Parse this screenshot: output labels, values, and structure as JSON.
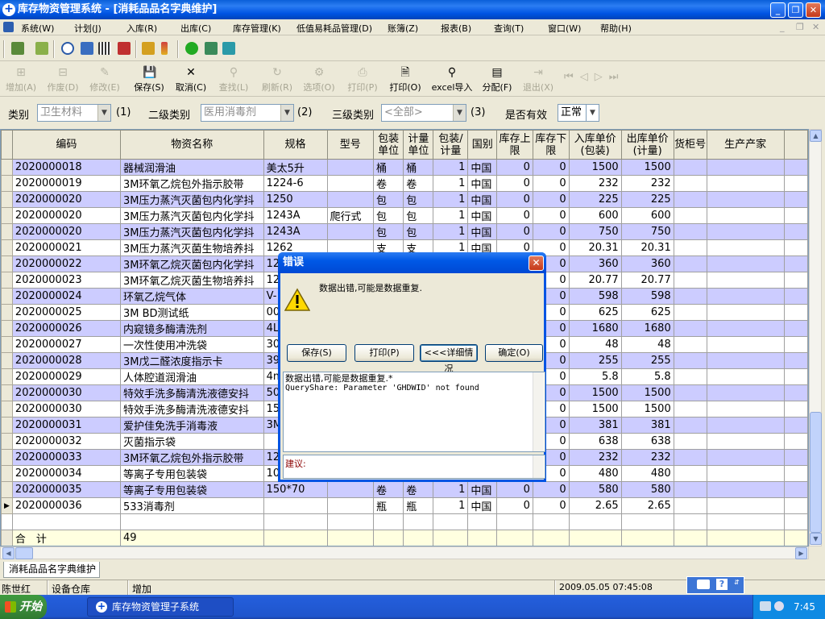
{
  "window": {
    "title": "库存物资管理系统 - [消耗品品名字典维护]"
  },
  "menu": [
    "系统(W)",
    "计划(J)",
    "入库(R)",
    "出库(C)",
    "库存管理(K)",
    "低值易耗品管理(D)",
    "账簿(Z)",
    "报表(B)",
    "查询(T)",
    "窗口(W)",
    "帮助(H)"
  ],
  "toolbar": {
    "add": "增加(A)",
    "void": "作废(D)",
    "modify": "修改(E)",
    "save": "保存(S)",
    "cancel": "取消(C)",
    "find": "查找(L)",
    "refresh": "刷新(R)",
    "options": "选项(O)",
    "print_dis": "打印(P)",
    "print": "打印(O)",
    "excel": "excel导入",
    "assign": "分配(F)",
    "exit": "退出(X)"
  },
  "filters": {
    "category_label": "类别",
    "category_value": "卫生材料",
    "category_idx": "(1)",
    "sub_label": "二级类别",
    "sub_value": "医用消毒剂",
    "sub_idx": "(2)",
    "third_label": "三级类别",
    "third_value": "<全部>",
    "third_idx": "(3)",
    "valid_label": "是否有效",
    "valid_value": "正常"
  },
  "grid": {
    "headers": [
      "编码",
      "物资名称",
      "规格",
      "型号",
      "包装单位",
      "计量单位",
      "包装/计量",
      "国别",
      "库存上限",
      "库存下限",
      "入库单价(包装)",
      "出库单价(计量)",
      "货柜号",
      "生产产家"
    ],
    "rows": [
      [
        "2020000018",
        "器械润滑油",
        "美太5升",
        "",
        "桶",
        "桶",
        "1",
        "中国",
        "0",
        "0",
        "1500",
        "1500",
        "",
        ""
      ],
      [
        "2020000019",
        "3M环氧乙烷包外指示胶带",
        "1224-6",
        "",
        "卷",
        "卷",
        "1",
        "中国",
        "0",
        "0",
        "232",
        "232",
        "",
        ""
      ],
      [
        "2020000020",
        "3M压力蒸汽灭菌包内化学抖",
        "1250",
        "",
        "包",
        "包",
        "1",
        "中国",
        "0",
        "0",
        "225",
        "225",
        "",
        ""
      ],
      [
        "2020000020",
        "3M压力蒸汽灭菌包内化学抖",
        "1243A",
        "爬行式",
        "包",
        "包",
        "1",
        "中国",
        "0",
        "0",
        "600",
        "600",
        "",
        ""
      ],
      [
        "2020000020",
        "3M压力蒸汽灭菌包内化学抖",
        "1243A",
        "",
        "包",
        "包",
        "1",
        "中国",
        "0",
        "0",
        "750",
        "750",
        "",
        ""
      ],
      [
        "2020000021",
        "3M压力蒸汽灭菌生物培养抖",
        "1262",
        "",
        "支",
        "支",
        "1",
        "中国",
        "0",
        "0",
        "20.31",
        "20.31",
        "",
        ""
      ],
      [
        "2020000022",
        "3M环氧乙烷灭菌包内化学抖",
        "12",
        "",
        "",
        "",
        "",
        "",
        "",
        "0",
        "360",
        "360",
        "",
        ""
      ],
      [
        "2020000023",
        "3M环氧乙烷灭菌生物培养抖",
        "12",
        "",
        "",
        "",
        "",
        "",
        "",
        "0",
        "20.77",
        "20.77",
        "",
        ""
      ],
      [
        "2020000024",
        "环氧乙烷气体",
        "V-",
        "",
        "",
        "",
        "",
        "",
        "",
        "0",
        "598",
        "598",
        "",
        ""
      ],
      [
        "2020000025",
        "3M BD测试纸",
        "00",
        "",
        "",
        "",
        "",
        "",
        "",
        "0",
        "625",
        "625",
        "",
        ""
      ],
      [
        "2020000026",
        "内窥镜多酶清洗剂",
        "4L",
        "",
        "",
        "",
        "",
        "",
        "",
        "0",
        "1680",
        "1680",
        "",
        ""
      ],
      [
        "2020000027",
        "一次性使用冲洗袋",
        "30",
        "",
        "",
        "",
        "",
        "",
        "",
        "0",
        "48",
        "48",
        "",
        ""
      ],
      [
        "2020000028",
        "3M戊二醛浓度指示卡",
        "39",
        "",
        "",
        "",
        "",
        "",
        "",
        "0",
        "255",
        "255",
        "",
        ""
      ],
      [
        "2020000029",
        "人体腔道润滑油",
        "4m",
        "",
        "",
        "",
        "",
        "",
        "",
        "0",
        "5.8",
        "5.8",
        "",
        ""
      ],
      [
        "2020000030",
        "特效手洗多酶清洗液德安抖",
        "50",
        "",
        "",
        "",
        "",
        "",
        "",
        "0",
        "1500",
        "1500",
        "",
        ""
      ],
      [
        "2020000030",
        "特效手洗多酶清洗液德安抖",
        "15",
        "",
        "",
        "",
        "",
        "",
        "",
        "0",
        "1500",
        "1500",
        "",
        ""
      ],
      [
        "2020000031",
        "爱护佳免洗手消毒液",
        "3M",
        "",
        "",
        "",
        "",
        "",
        "",
        "0",
        "381",
        "381",
        "",
        ""
      ],
      [
        "2020000032",
        "灭菌指示袋",
        "",
        "",
        "",
        "",
        "",
        "",
        "",
        "0",
        "638",
        "638",
        "",
        ""
      ],
      [
        "2020000033",
        "3M环氧乙烷包外指示胶带",
        "12",
        "",
        "",
        "",
        "",
        "",
        "",
        "0",
        "232",
        "232",
        "",
        ""
      ],
      [
        "2020000034",
        "等离子专用包装袋",
        "10",
        "",
        "",
        "",
        "",
        "",
        "",
        "0",
        "480",
        "480",
        "",
        ""
      ],
      [
        "2020000035",
        "等离子专用包装袋",
        "150*70",
        "",
        "卷",
        "卷",
        "1",
        "中国",
        "0",
        "0",
        "580",
        "580",
        "",
        ""
      ],
      [
        "2020000036",
        "533消毒剂",
        "",
        "",
        "瓶",
        "瓶",
        "1",
        "中国",
        "0",
        "0",
        "2.65",
        "2.65",
        "",
        ""
      ]
    ],
    "total_label": "合　计",
    "total_value": "49"
  },
  "dialog": {
    "title": "错误",
    "message": "数据出错,可能是数据重复.",
    "save": "保存(S)",
    "print": "打印(P)",
    "details": "<<<详细情况",
    "ok": "确定(O)",
    "detail_line1": "数据出错,可能是数据重复.*",
    "detail_line2": "QueryShare: Parameter 'GHDWID' not found",
    "suggestion": "建议:"
  },
  "tab": "消耗品品名字典维护",
  "status": {
    "user": "陈世红",
    "warehouse": "设备仓库",
    "mode": "增加",
    "datetime": "2009.05.05 07:45:08"
  },
  "taskbar": {
    "start": "开始",
    "app": "库存物资管理子系统",
    "clock": "7:45"
  }
}
